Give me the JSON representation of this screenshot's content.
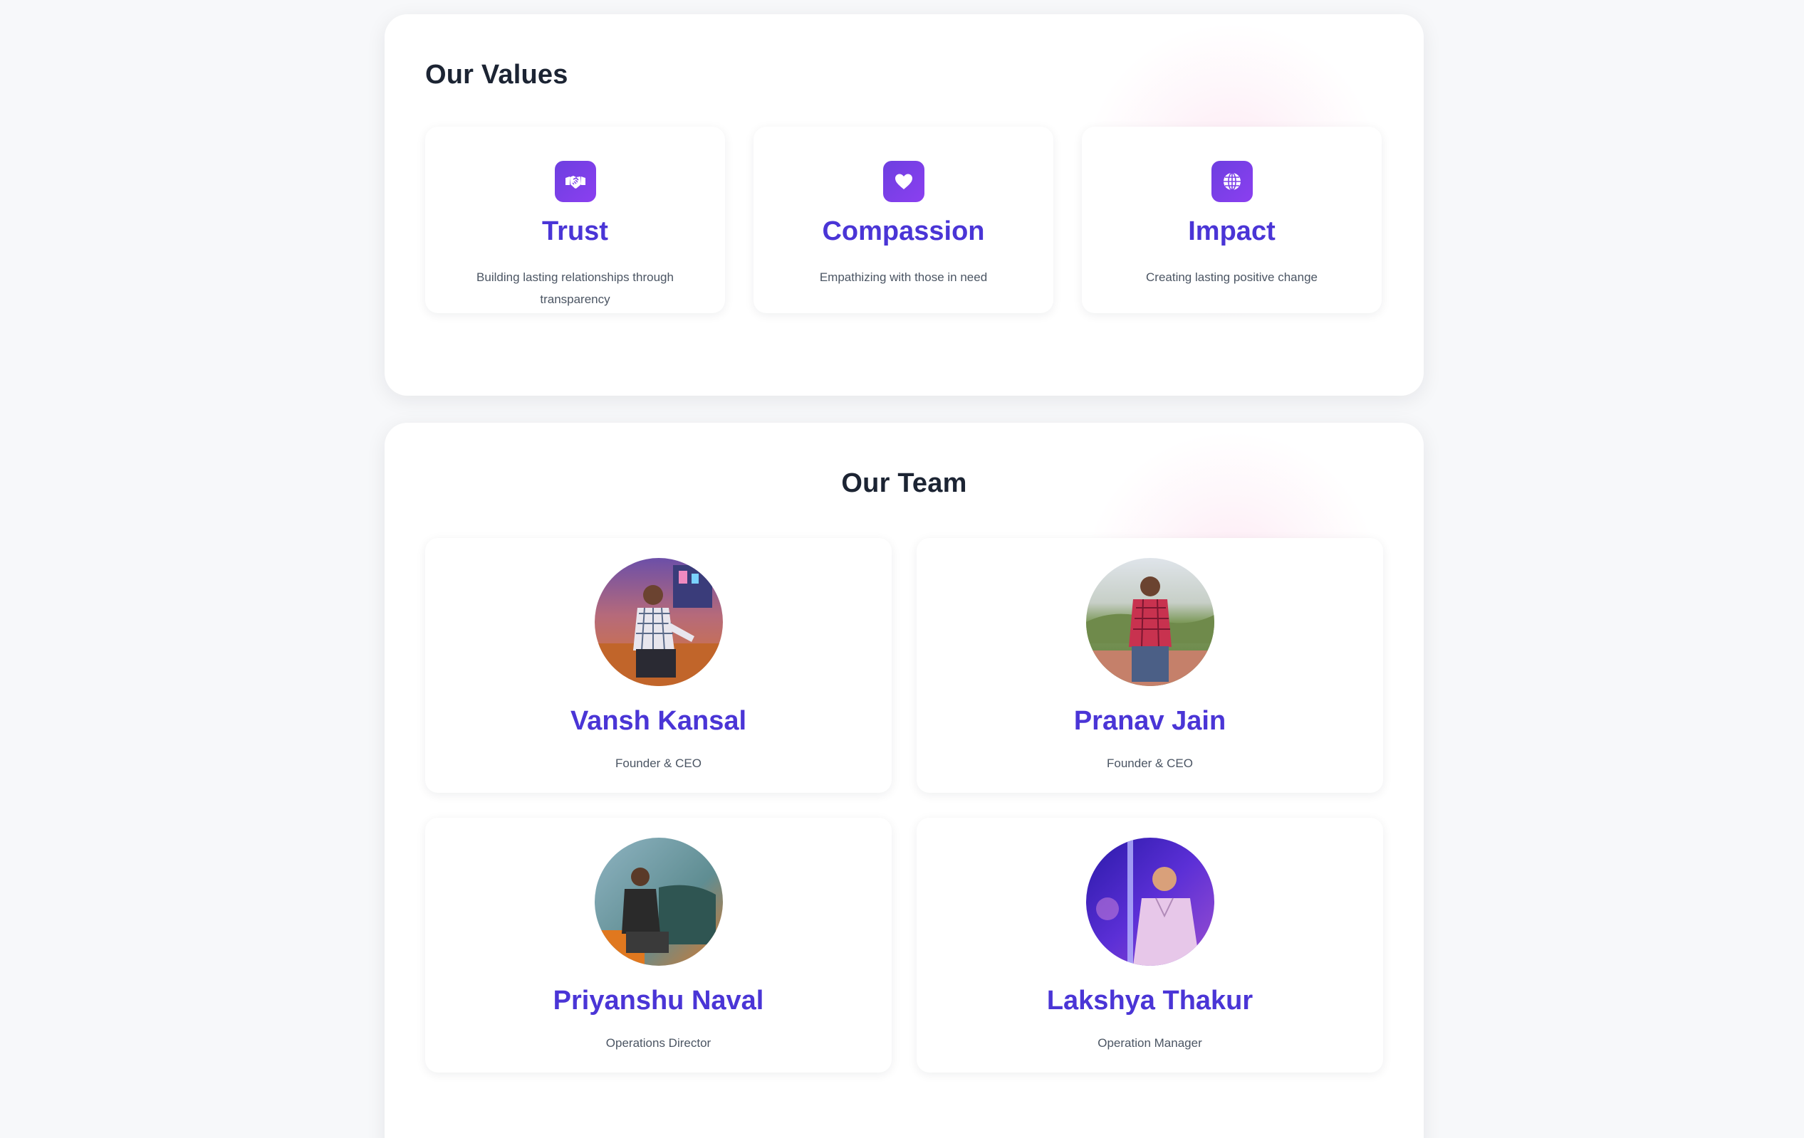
{
  "values": {
    "title": "Our Values",
    "items": [
      {
        "title": "Trust",
        "description": "Building lasting relationships through transparency",
        "icon": "handshake-icon"
      },
      {
        "title": "Compassion",
        "description": "Empathizing with those in need",
        "icon": "heart-icon"
      },
      {
        "title": "Impact",
        "description": "Creating lasting positive change",
        "icon": "globe-icon"
      }
    ]
  },
  "team": {
    "title": "Our Team",
    "members": [
      {
        "name": "Vansh Kansal",
        "role": "Founder & CEO"
      },
      {
        "name": "Pranav Jain",
        "role": "Founder & CEO"
      },
      {
        "name": "Priyanshu Naval",
        "role": "Operations Director"
      },
      {
        "name": "Lakshya Thakur",
        "role": "Operation Manager"
      }
    ]
  },
  "colors": {
    "accent": "#4a35d6",
    "icon_bg": "#7b3fe8",
    "heading": "#1c2433",
    "muted_text": "#4b5563",
    "page_bg": "#f7f8fa"
  }
}
